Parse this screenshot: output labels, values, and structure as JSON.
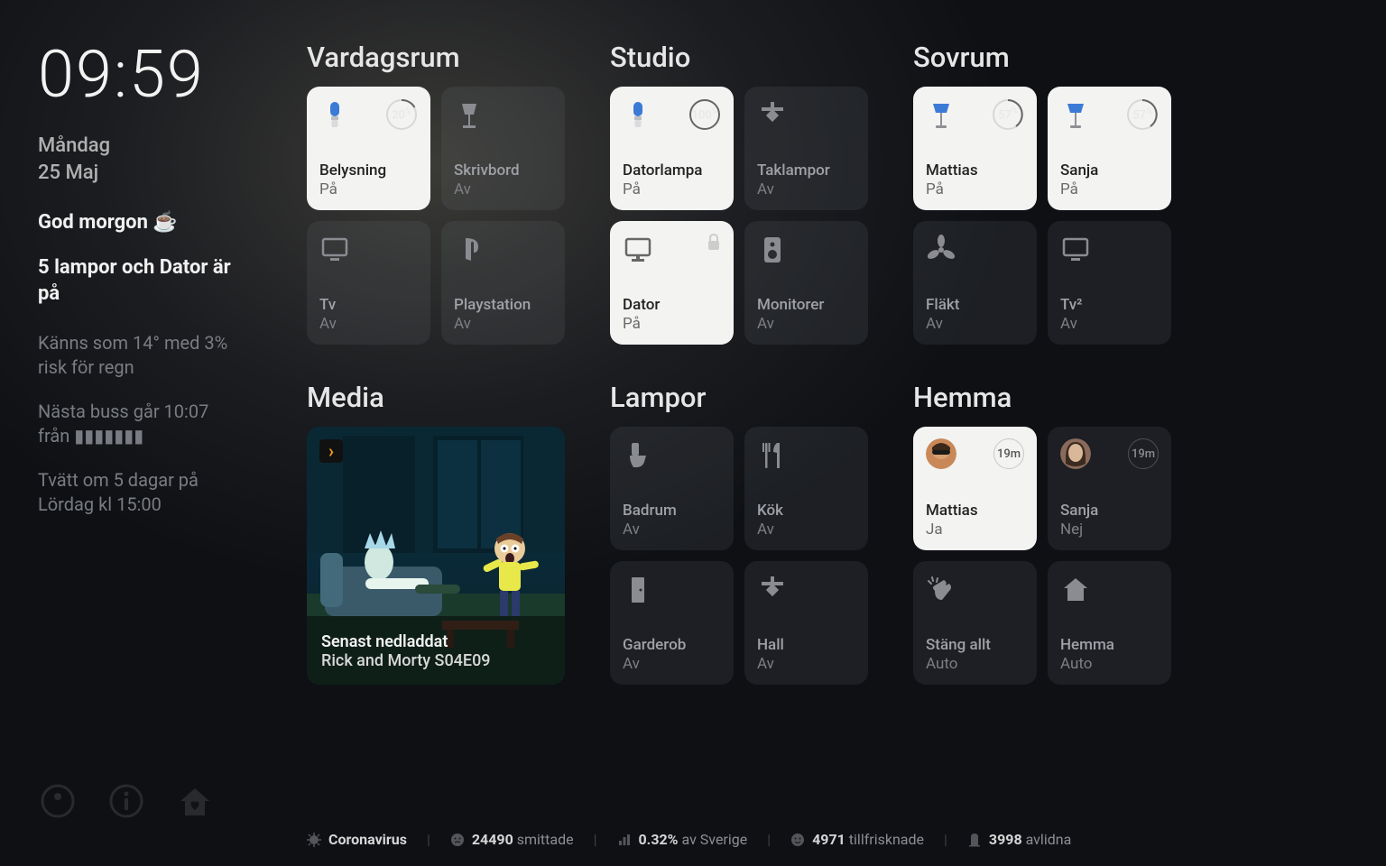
{
  "sidebar": {
    "time": "09:59",
    "weekday": "Måndag",
    "date": "25 Maj",
    "greeting": "God morgon ☕",
    "summary": "5 lampor och Dator är på",
    "weather": "Känns som 14° med 3% risk för regn",
    "bus": "Nästa buss går 10:07 från ▮▮▮▮▮▮▮",
    "laundry": "Tvätt om 5 dagar på Lördag kl 15:00"
  },
  "groups": {
    "vardagsrum": {
      "title": "Vardagsrum",
      "tiles": [
        {
          "name": "Belysning",
          "state": "På",
          "on": true,
          "icon": "bulb",
          "pct": "20"
        },
        {
          "name": "Skrivbord",
          "state": "Av",
          "on": false,
          "icon": "lamp"
        },
        {
          "name": "Tv",
          "state": "Av",
          "on": false,
          "icon": "tv"
        },
        {
          "name": "Playstation",
          "state": "Av",
          "on": false,
          "icon": "ps"
        }
      ]
    },
    "studio": {
      "title": "Studio",
      "tiles": [
        {
          "name": "Datorlampa",
          "state": "På",
          "on": true,
          "icon": "bulb",
          "pct": "100"
        },
        {
          "name": "Taklampor",
          "state": "Av",
          "on": false,
          "icon": "ceiling"
        },
        {
          "name": "Dator",
          "state": "På",
          "on": true,
          "icon": "monitor",
          "lock": true
        },
        {
          "name": "Monitorer",
          "state": "Av",
          "on": false,
          "icon": "speaker"
        }
      ]
    },
    "sovrum": {
      "title": "Sovrum",
      "tiles": [
        {
          "name": "Mattias",
          "state": "På",
          "on": true,
          "icon": "bedlamp",
          "pct": "57"
        },
        {
          "name": "Sanja",
          "state": "På",
          "on": true,
          "icon": "bedlamp",
          "pct": "57"
        },
        {
          "name": "Fläkt",
          "state": "Av",
          "on": false,
          "icon": "fan"
        },
        {
          "name": "Tv²",
          "state": "Av",
          "on": false,
          "icon": "tv"
        }
      ]
    },
    "media": {
      "title": "Media",
      "line1": "Senast nedladdat",
      "line2": "Rick and Morty S04E09"
    },
    "lampor": {
      "title": "Lampor",
      "tiles": [
        {
          "name": "Badrum",
          "state": "Av",
          "on": false,
          "icon": "toilet"
        },
        {
          "name": "Kök",
          "state": "Av",
          "on": false,
          "icon": "utensils"
        },
        {
          "name": "Garderob",
          "state": "Av",
          "on": false,
          "icon": "door"
        },
        {
          "name": "Hall",
          "state": "Av",
          "on": false,
          "icon": "ceiling"
        }
      ]
    },
    "hemma": {
      "title": "Hemma",
      "tiles": [
        {
          "name": "Mattias",
          "state": "Ja",
          "on": true,
          "icon": "avatar1",
          "badge": "19m"
        },
        {
          "name": "Sanja",
          "state": "Nej",
          "on": false,
          "icon": "avatar2",
          "badge": "19m"
        },
        {
          "name": "Stäng allt",
          "state": "Auto",
          "on": false,
          "icon": "clap"
        },
        {
          "name": "Hemma",
          "state": "Auto",
          "on": false,
          "icon": "home"
        }
      ]
    }
  },
  "footer": {
    "label": "Coronavirus",
    "infected_n": "24490",
    "infected_t": "smittade",
    "pct_n": "0.32%",
    "pct_t": "av Sverige",
    "recovered_n": "4971",
    "recovered_t": "tillfrisknade",
    "dead_n": "3998",
    "dead_t": "avlidna"
  }
}
